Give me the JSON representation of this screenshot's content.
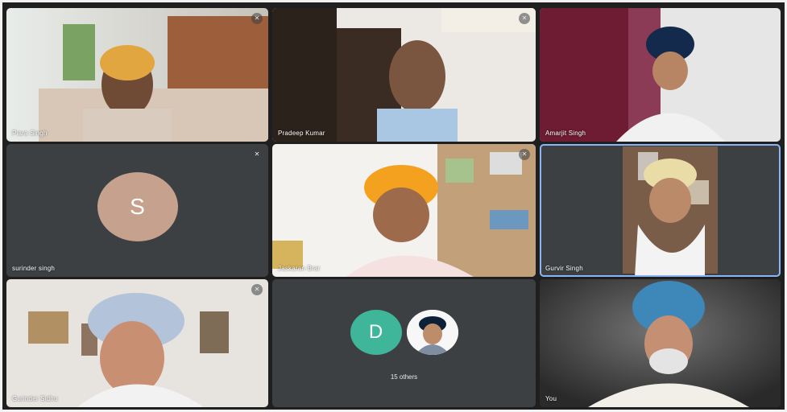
{
  "meeting": {
    "participants": [
      {
        "name": "Piara Singh",
        "muted": true
      },
      {
        "name": "Pradeep Kumar",
        "muted": true
      },
      {
        "name": "Amarjit Singh",
        "muted": false
      },
      {
        "name": "surinder singh",
        "muted": true,
        "avatar_letter": "S",
        "avatar_color": "#c6a28e"
      },
      {
        "name": "Jaskaran Brar",
        "muted": true
      },
      {
        "name": "Gurvir Singh",
        "muted": false,
        "speaking": true
      },
      {
        "name": "Gurinder Sidhu",
        "muted": true
      },
      {
        "name": "You",
        "muted": false
      }
    ],
    "others_tile": {
      "avatar_letter": "D",
      "avatar_color": "#3fb59a",
      "label": "15 others"
    }
  }
}
